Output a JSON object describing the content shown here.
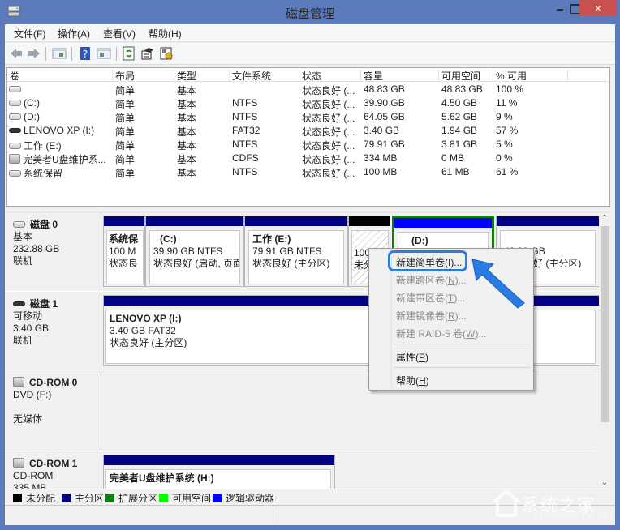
{
  "window": {
    "title": "磁盘管理",
    "close_glyph": "×"
  },
  "menubar": {
    "items": [
      "文件(F)",
      "操作(A)",
      "查看(V)",
      "帮助(H)"
    ]
  },
  "toolbar": {
    "icons": [
      "back-icon",
      "forward-icon",
      "show-hide-console-tree-icon",
      "help-icon",
      "show-hide-action-pane-icon",
      "refresh-icon",
      "rescan-disks-icon",
      "properties-icon"
    ]
  },
  "volume_list": {
    "columns": [
      "卷",
      "布局",
      "类型",
      "文件系统",
      "状态",
      "容量",
      "可用空间",
      "% 可用"
    ],
    "rows": [
      {
        "icon": "drive",
        "volume": "",
        "layout": "简单",
        "type": "基本",
        "fs": "",
        "status": "状态良好 (...",
        "capacity": "48.83 GB",
        "free": "48.83 GB",
        "pct": "100 %"
      },
      {
        "icon": "drive",
        "volume": "(C:)",
        "layout": "简单",
        "type": "基本",
        "fs": "NTFS",
        "status": "状态良好 (...",
        "capacity": "39.90 GB",
        "free": "4.50 GB",
        "pct": "11 %"
      },
      {
        "icon": "drive",
        "volume": "(D:)",
        "layout": "简单",
        "type": "基本",
        "fs": "NTFS",
        "status": "状态良好 (...",
        "capacity": "64.05 GB",
        "free": "5.62 GB",
        "pct": "9 %"
      },
      {
        "icon": "usb",
        "volume": "LENOVO XP (I:)",
        "layout": "简单",
        "type": "基本",
        "fs": "FAT32",
        "status": "状态良好 (...",
        "capacity": "3.40 GB",
        "free": "1.94 GB",
        "pct": "57 %"
      },
      {
        "icon": "drive",
        "volume": "工作 (E:)",
        "layout": "简单",
        "type": "基本",
        "fs": "NTFS",
        "status": "状态良好 (...",
        "capacity": "79.91 GB",
        "free": "3.81 GB",
        "pct": "5 %"
      },
      {
        "icon": "cd",
        "volume": "完美者U盘维护系...",
        "layout": "简单",
        "type": "基本",
        "fs": "CDFS",
        "status": "状态良好 (...",
        "capacity": "334 MB",
        "free": "0 MB",
        "pct": "0 %"
      },
      {
        "icon": "drive",
        "volume": "系统保留",
        "layout": "简单",
        "type": "基本",
        "fs": "NTFS",
        "status": "状态良好 (...",
        "capacity": "100 MB",
        "free": "61 MB",
        "pct": "61 %"
      }
    ]
  },
  "disks": [
    {
      "name": "磁盘 0",
      "line1": "基本",
      "line2": "232.88 GB",
      "line3": "联机",
      "partitions": [
        {
          "kind": "primary",
          "name": "系统保",
          "size": "100 M",
          "status": "状态良"
        },
        {
          "kind": "primary",
          "name": "(C:)",
          "size": "39.90 GB NTFS",
          "status": "状态良好 (启动, 页面"
        },
        {
          "kind": "primary",
          "name": "工作  (E:)",
          "size": "79.91 GB NTFS",
          "status": "状态良好 (主分区)"
        },
        {
          "kind": "unallocated",
          "name": "",
          "size": "100",
          "status": "未分"
        },
        {
          "kind": "logical-selected",
          "name": "(D:)",
          "size": "",
          "status": ""
        },
        {
          "kind": "primary",
          "name": "",
          "size": "48.83 GB",
          "status": "状态良好 (主分区)"
        }
      ]
    },
    {
      "name": "磁盘 1",
      "line1": "可移动",
      "line2": "3.40 GB",
      "line3": "联机",
      "partitions": [
        {
          "kind": "primary",
          "name": "LENOVO XP  (I:)",
          "size": "3.40 GB FAT32",
          "status": "状态良好 (主分区)"
        }
      ]
    },
    {
      "name": "CD-ROM 0",
      "line1": "DVD (F:)",
      "line2": "",
      "line3": "无媒体",
      "partitions": []
    },
    {
      "name": "CD-ROM 1",
      "line1": "CD-ROM",
      "line2": "335 MB",
      "line3": "",
      "partitions": [
        {
          "kind": "primary",
          "name": "完美者U盘维护系统  (H:)",
          "size": "",
          "status": ""
        }
      ]
    }
  ],
  "legend": [
    {
      "label": "未分配",
      "color": "#000000"
    },
    {
      "label": "主分区",
      "color": "#000080"
    },
    {
      "label": "扩展分区",
      "color": "#107c10"
    },
    {
      "label": "可用空间",
      "color": "#00ff00"
    },
    {
      "label": "逻辑驱动器",
      "color": "#0000ff"
    }
  ],
  "context_menu": {
    "items": [
      {
        "label": "新建简单卷(",
        "key": "I",
        "suffix": ")...",
        "enabled": true,
        "highlighted": true
      },
      {
        "label": "新建跨区卷(",
        "key": "N",
        "suffix": ")...",
        "enabled": false
      },
      {
        "label": "新建带区卷(",
        "key": "T",
        "suffix": ")...",
        "enabled": false
      },
      {
        "label": "新建镜像卷(",
        "key": "R",
        "suffix": ")...",
        "enabled": false
      },
      {
        "label": "新建 RAID-5 卷(",
        "key": "W",
        "suffix": ")...",
        "enabled": false
      },
      {
        "label": "属性(",
        "key": "P",
        "suffix": ")",
        "enabled": true
      },
      {
        "label": "帮助(",
        "key": "H",
        "suffix": ")",
        "enabled": true
      }
    ]
  },
  "watermark": {
    "text": "系统之家",
    "sub": "XITONGZHIJIA.NET"
  },
  "colors": {
    "titlebar": "#5b7bbd",
    "close_button": "#c7514e",
    "primary_partition": "#000080",
    "logical_drive": "#0000ff",
    "extended_partition": "#107c10",
    "annotation": "#2a7ce4"
  }
}
